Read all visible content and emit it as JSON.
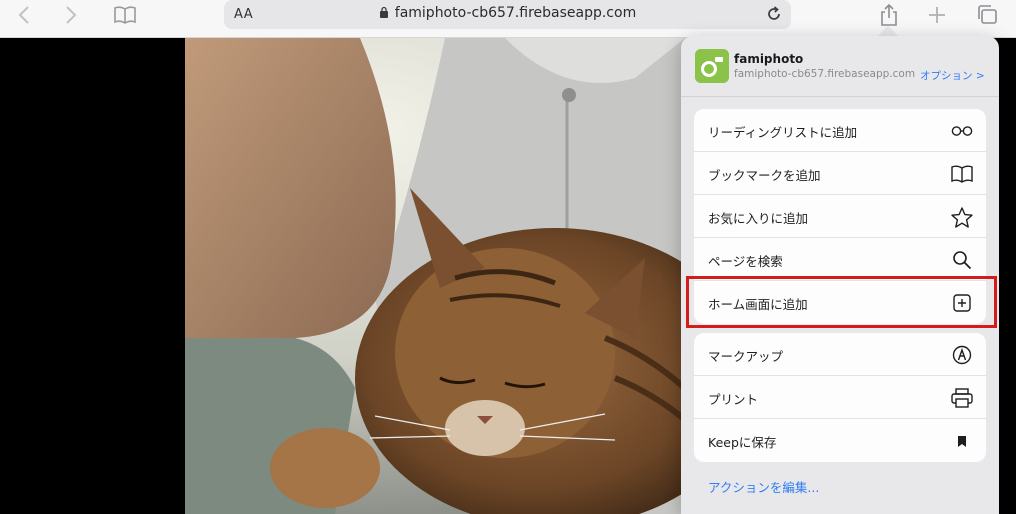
{
  "browser": {
    "url_aa": "AA",
    "url": "famiphoto-cb657.firebaseapp.com"
  },
  "share": {
    "app_name": "famiphoto",
    "app_url": "famiphoto-cb657.firebaseapp.com",
    "options_label": "オプション >",
    "group1": [
      {
        "label": "リーディングリストに追加",
        "icon": "glasses-icon"
      },
      {
        "label": "ブックマークを追加",
        "icon": "book-icon"
      },
      {
        "label": "お気に入りに追加",
        "icon": "star-icon"
      },
      {
        "label": "ページを検索",
        "icon": "search-icon"
      },
      {
        "label": "ホーム画面に追加",
        "icon": "add-square-icon"
      }
    ],
    "group2": [
      {
        "label": "マークアップ",
        "icon": "markup-icon"
      },
      {
        "label": "プリント",
        "icon": "printer-icon"
      },
      {
        "label": "Keepに保存",
        "icon": "bookmark-icon"
      }
    ],
    "edit_actions": "アクションを編集..."
  },
  "colors": {
    "accent": "#2f7cf6",
    "highlight": "#d41c1c",
    "app_icon": "#8bc34a"
  }
}
